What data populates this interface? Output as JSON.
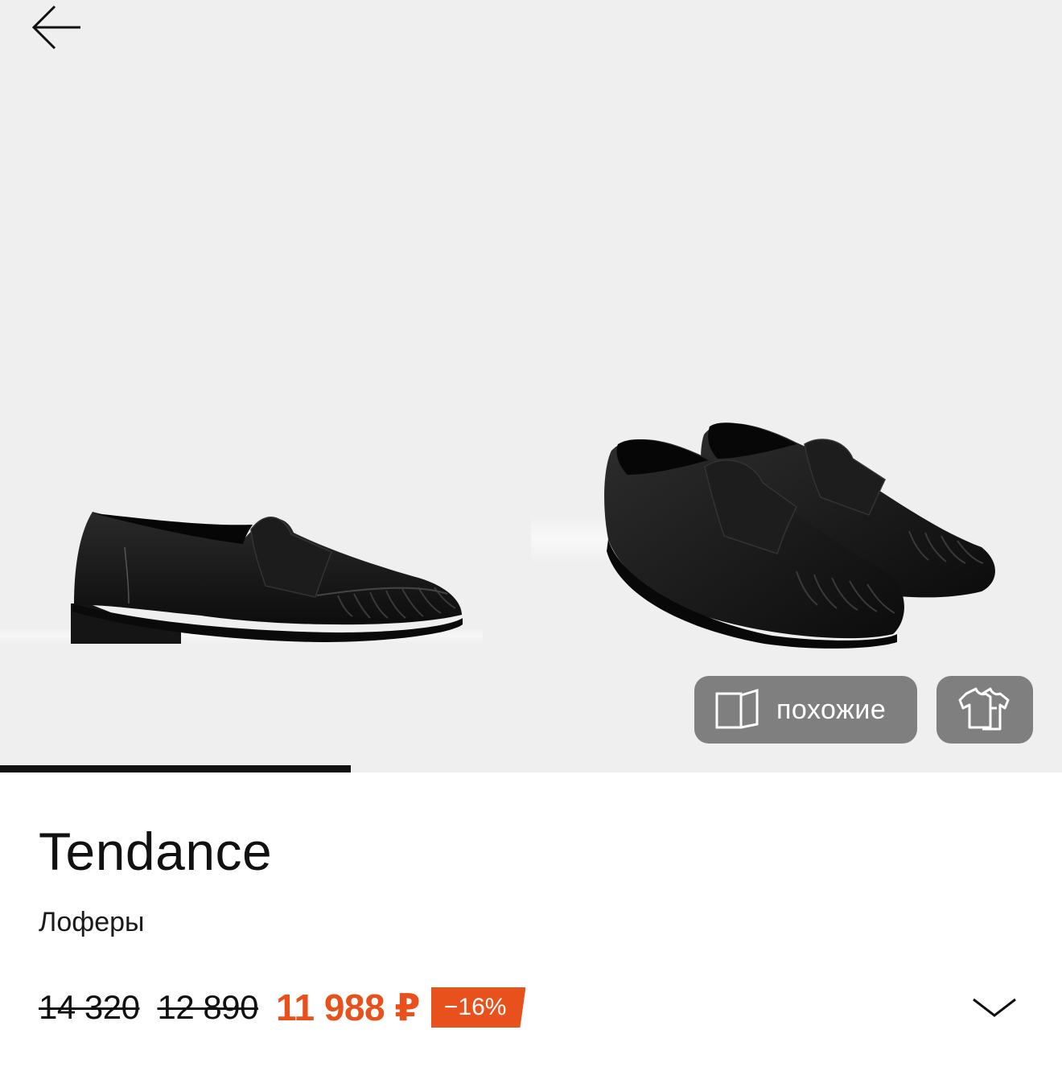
{
  "navigation": {
    "back_icon": "arrow-left-icon"
  },
  "gallery": {
    "photos": [
      {
        "alt": "loafer-side-view"
      },
      {
        "alt": "loafers-pair-front-view"
      }
    ],
    "progress": 0.33,
    "similar_button": {
      "icon": "cards-icon",
      "label": "похожие"
    },
    "look_button": {
      "icon": "outfit-icon"
    }
  },
  "product": {
    "brand": "Tendance",
    "type": "Лоферы",
    "prices": {
      "old_prices": [
        "14 320",
        "12 890"
      ],
      "current": "11 988 ₽",
      "discount": "−16%"
    },
    "expand_icon": "chevron-down-icon"
  },
  "colors": {
    "accent": "#e8501c",
    "gallery_bg": "#efefef",
    "pill_bg": "#7f7f7f",
    "text": "#111111"
  }
}
